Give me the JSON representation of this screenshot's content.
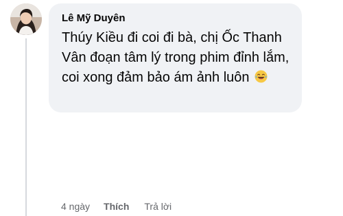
{
  "comment": {
    "author": "Lê Mỹ Duyên",
    "text": "Thúy Kiều đi coi đi bà, chị Ốc Thanh Vân đoạn tâm lý trong phim đỉnh lắm, coi xong đảm bảo ám ảnh luôn",
    "emoji": "laughing-tears-emoji",
    "avatar_icon": "user-avatar"
  },
  "actions": {
    "time": "4 ngày",
    "like_label": "Thích",
    "reply_label": "Trả lời"
  },
  "colors": {
    "bubble": "#f0f2f5",
    "text": "#050505",
    "secondary": "#65676b",
    "thread_line": "#d6d9dd"
  }
}
